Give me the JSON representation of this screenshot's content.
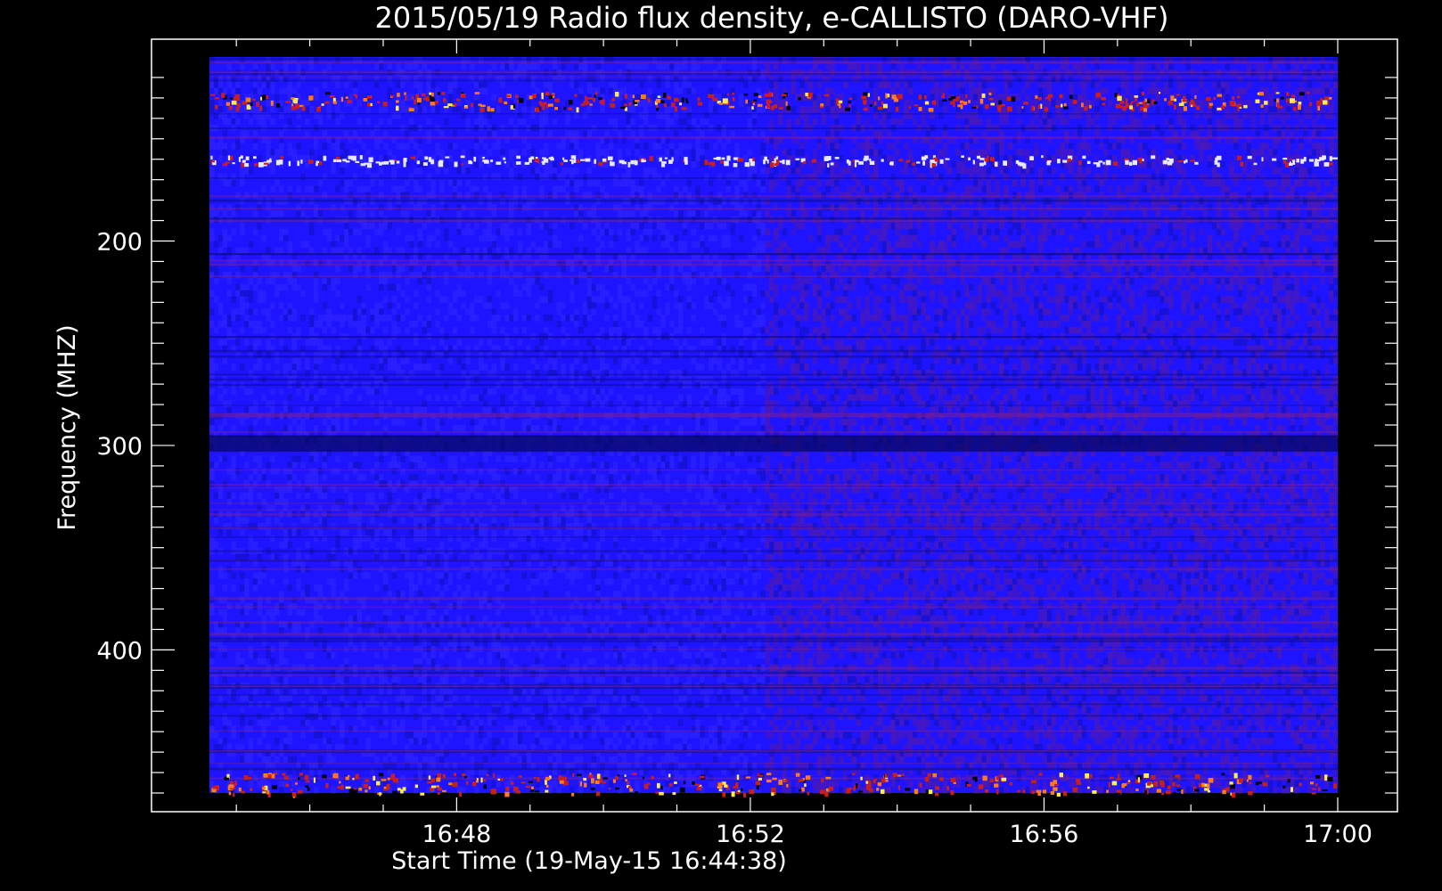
{
  "chart_data": {
    "type": "heatmap",
    "title": "2015/05/19  Radio flux density, e-CALLISTO (DARO-VHF)",
    "xlabel": "Start Time (19-May-15 16:44:38)",
    "ylabel": "Frequency (MHZ)",
    "x_tick_labels": [
      "16:48",
      "16:52",
      "16:56",
      "17:00"
    ],
    "y_tick_labels": [
      "200",
      "300",
      "400"
    ],
    "y_ticks": [
      200,
      300,
      400
    ],
    "xlim": [
      "16:44:38",
      "17:00:00"
    ],
    "ylim": [
      110,
      470
    ],
    "colormap": "blue-red-yellow",
    "colors": {
      "background": "#000000",
      "low": "#1e14ff",
      "mid": "#c81e1e",
      "high": "#ffeb50",
      "frame": "#ffffff"
    },
    "features": [
      {
        "freq_range": [
          127,
          135
        ],
        "intensity": "high",
        "note": "bright broadband interference band"
      },
      {
        "freq_range": [
          158,
          162
        ],
        "intensity": "high",
        "note": "periodic white interference line"
      },
      {
        "freq_range": [
          295,
          303
        ],
        "intensity": "low",
        "note": "dark absorption band"
      },
      {
        "freq_range": [
          460,
          470
        ],
        "intensity": "high",
        "note": "bright band at band edge"
      }
    ]
  }
}
